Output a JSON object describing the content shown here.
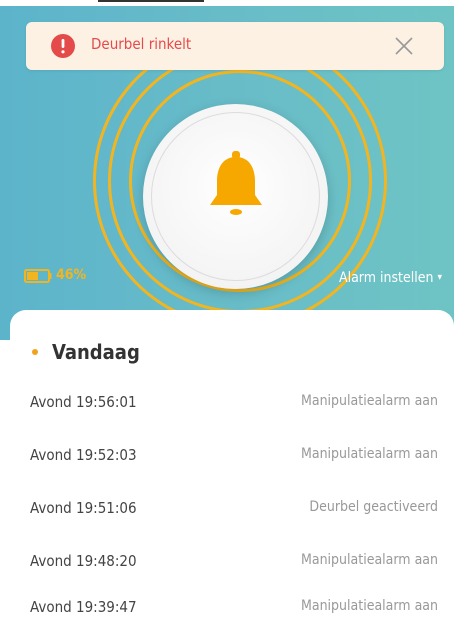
{
  "banner": {
    "message": "Deurbel rinkelt",
    "icon": "alert-icon",
    "close_icon": "close-icon",
    "message_color": "#e44a4a"
  },
  "device": {
    "battery": "46%",
    "battery_color": "#f3b51f",
    "alarm_setting_label": "Alarm instellen",
    "alarm_setting_caret": "▾"
  },
  "log": {
    "section_title": "Vandaag",
    "entries": [
      {
        "time": "Avond  19:56:01",
        "event": "Manipulatiealarm aan"
      },
      {
        "time": "Avond  19:52:03",
        "event": "Manipulatiealarm aan"
      },
      {
        "time": "Avond  19:51:06",
        "event": "Deurbel geactiveerd"
      },
      {
        "time": "Avond  19:48:20",
        "event": "Manipulatiealarm aan"
      },
      {
        "time": "Avond  19:39:47",
        "event": "Manipulatiealarm aan"
      }
    ]
  },
  "colors": {
    "accent": "#f3b51f",
    "hero_bg": "#68bcc8"
  }
}
